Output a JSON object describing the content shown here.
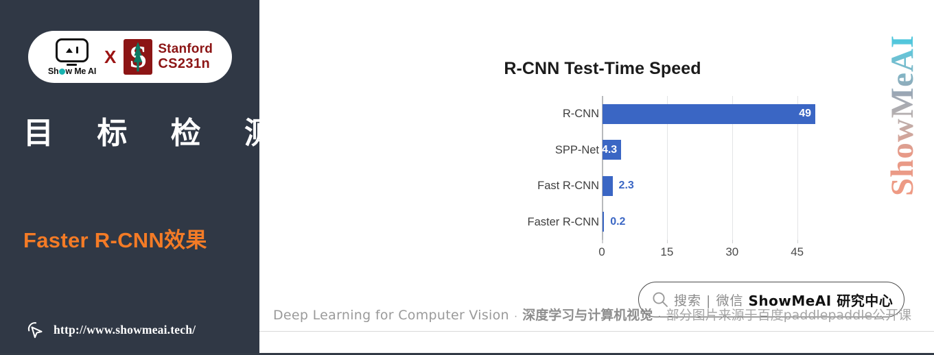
{
  "slide": {
    "background_dark": "#303845",
    "background_light": "#ffffff",
    "accent_orange": "#f47b26",
    "accent_blue": "#3a66c4",
    "stanford_red": "#8C1515"
  },
  "sidebar": {
    "logo": {
      "brand_name": "Show Me AI",
      "brand_name_pre": "Sh",
      "brand_name_post": "w Me AI",
      "cross_label": "X",
      "partner_line1": "Stanford",
      "partner_line2": "CS231n",
      "stanford_letter": "S"
    },
    "headline": "目 标 检 测",
    "subtitle": "Faster R-CNN效果",
    "url": "http://www.showmeai.tech/"
  },
  "watermark": {
    "text": "ShowMeAI"
  },
  "chart_data": {
    "type": "bar",
    "orientation": "horizontal",
    "title": "R-CNN Test-Time Speed",
    "xlabel": "",
    "ylabel": "",
    "categories": [
      "R-CNN",
      "SPP-Net",
      "Fast R-CNN",
      "Faster R-CNN"
    ],
    "values": [
      49,
      4.3,
      2.3,
      0.2
    ],
    "value_labels": [
      "49",
      "4.3",
      "2.3",
      "0.2"
    ],
    "label_inside": [
      true,
      true,
      false,
      false
    ],
    "xlim": [
      0,
      49
    ],
    "xticks": [
      0,
      15,
      30,
      45
    ],
    "xtick_labels": [
      "0",
      "15",
      "30",
      "45"
    ],
    "grid": "vertical",
    "legend": "none",
    "bar_color": "#3a66c4",
    "label_color_inside": "#ffffff",
    "label_color_outside": "#3a66c4"
  },
  "search": {
    "icon": "search-icon",
    "gray_text": "搜索 | 微信",
    "bold_text": "ShowMeAI 研究中心"
  },
  "footer": {
    "english": "Deep Learning for Computer Vision",
    "sep1": "·",
    "chinese_bold": "深度学习与计算机视觉",
    "sep2": "·",
    "chinese_light": "部分图片来源于百度paddlepaddle公开课"
  }
}
